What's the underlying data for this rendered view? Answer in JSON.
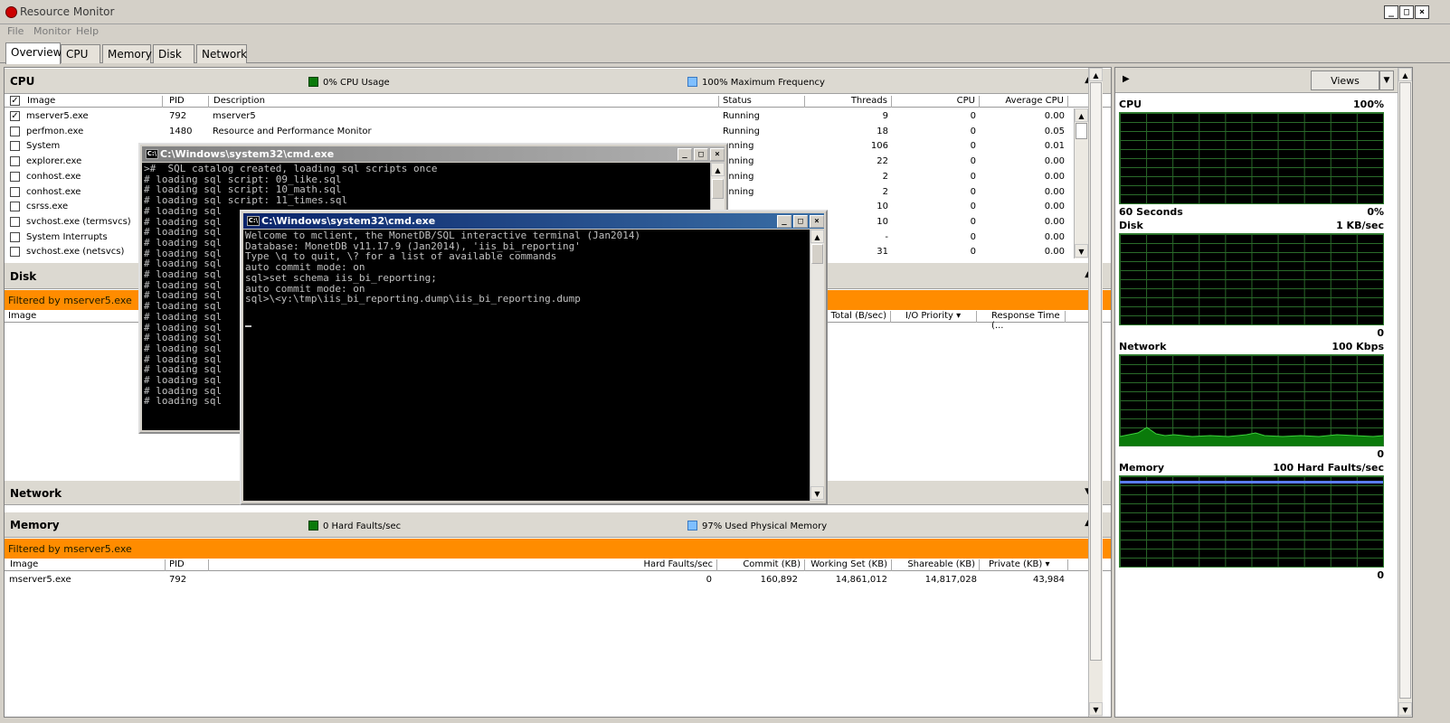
{
  "window": {
    "title": "Resource Monitor",
    "minimize": "_",
    "maximize": "□",
    "close": "×"
  },
  "menu": [
    "File",
    "Monitor",
    "Help"
  ],
  "tabs": [
    "Overview",
    "CPU",
    "Memory",
    "Disk",
    "Network"
  ],
  "cpu": {
    "title": "CPU",
    "usage": "0% CPU Usage",
    "frequency": "100% Maximum Frequency",
    "columns": [
      "Image",
      "PID",
      "Description",
      "Status",
      "Threads",
      "CPU",
      "Average CPU"
    ],
    "rows": [
      {
        "checked": true,
        "image": "mserver5.exe",
        "pid": "792",
        "desc": "mserver5",
        "status": "Running",
        "threads": "9",
        "cpu": "0",
        "avg": "0.00"
      },
      {
        "checked": false,
        "image": "perfmon.exe",
        "pid": "1480",
        "desc": "Resource and Performance Monitor",
        "status": "Running",
        "threads": "18",
        "cpu": "0",
        "avg": "0.05"
      },
      {
        "checked": false,
        "image": "System",
        "pid": "",
        "desc": "",
        "status": "unning",
        "threads": "106",
        "cpu": "0",
        "avg": "0.01"
      },
      {
        "checked": false,
        "image": "explorer.exe",
        "pid": "",
        "desc": "",
        "status": "unning",
        "threads": "22",
        "cpu": "0",
        "avg": "0.00"
      },
      {
        "checked": false,
        "image": "conhost.exe",
        "pid": "",
        "desc": "",
        "status": "unning",
        "threads": "2",
        "cpu": "0",
        "avg": "0.00"
      },
      {
        "checked": false,
        "image": "conhost.exe",
        "pid": "",
        "desc": "",
        "status": "unning",
        "threads": "2",
        "cpu": "0",
        "avg": "0.00"
      },
      {
        "checked": false,
        "image": "csrss.exe",
        "pid": "",
        "desc": "",
        "status": "",
        "threads": "10",
        "cpu": "0",
        "avg": "0.00"
      },
      {
        "checked": false,
        "image": "svchost.exe (termsvcs)",
        "pid": "",
        "desc": "",
        "status": "",
        "threads": "10",
        "cpu": "0",
        "avg": "0.00"
      },
      {
        "checked": false,
        "image": "System Interrupts",
        "pid": "",
        "desc": "",
        "status": "",
        "threads": "-",
        "cpu": "0",
        "avg": "0.00"
      },
      {
        "checked": false,
        "image": "svchost.exe (netsvcs)",
        "pid": "",
        "desc": "",
        "status": "",
        "threads": "31",
        "cpu": "0",
        "avg": "0.00"
      }
    ]
  },
  "disk": {
    "title": "Disk",
    "filter": "Filtered by mserver5.exe",
    "columns": [
      "Image",
      "Total (B/sec)",
      "I/O Priority",
      "Response Time (..."
    ]
  },
  "network": {
    "title": "Network"
  },
  "memory": {
    "title": "Memory",
    "hard_faults": "0 Hard Faults/sec",
    "used": "97% Used Physical Memory",
    "filter": "Filtered by mserver5.exe",
    "columns": [
      "Image",
      "PID",
      "Hard Faults/sec",
      "Commit (KB)",
      "Working Set (KB)",
      "Shareable (KB)",
      "Private (KB)"
    ],
    "rows": [
      {
        "image": "mserver5.exe",
        "pid": "792",
        "faults": "0",
        "commit": "160,892",
        "ws": "14,861,012",
        "share": "14,817,028",
        "private": "43,984"
      }
    ]
  },
  "right": {
    "views": "Views",
    "graphs": [
      {
        "name": "CPU",
        "max": "100%",
        "foot_left": "60 Seconds",
        "foot_right": "0%"
      },
      {
        "name": "Disk",
        "max": "1 KB/sec",
        "foot_left": "",
        "foot_right": "0"
      },
      {
        "name": "Network",
        "max": "100 Kbps",
        "foot_left": "",
        "foot_right": "0"
      },
      {
        "name": "Memory",
        "max": "100 Hard Faults/sec",
        "foot_left": "",
        "foot_right": "0"
      }
    ]
  },
  "cmd1": {
    "title": "C:\\Windows\\system32\\cmd.exe",
    "lines": [
      ">#  SQL catalog created, loading sql scripts once",
      "# loading sql script: 09_like.sql",
      "# loading sql script: 10_math.sql",
      "# loading sql script: 11_times.sql",
      "# loading sql",
      "# loading sql",
      "# loading sql",
      "# loading sql",
      "# loading sql",
      "# loading sql",
      "# loading sql",
      "# loading sql",
      "# loading sql",
      "# loading sql",
      "# loading sql",
      "# loading sql",
      "# loading sql",
      "# loading sql",
      "# loading sql",
      "# loading sql",
      "# loading sql",
      "# loading sql",
      "# loading sql"
    ]
  },
  "cmd2": {
    "title": "C:\\Windows\\system32\\cmd.exe",
    "lines": [
      "Welcome to mclient, the MonetDB/SQL interactive terminal (Jan2014)",
      "Database: MonetDB v11.17.9 (Jan2014), 'iis_bi_reporting'",
      "Type \\q to quit, \\? for a list of available commands",
      "auto commit mode: on",
      "sql>set schema iis_bi_reporting;",
      "auto commit mode: on",
      "sql>\\<y:\\tmp\\iis_bi_reporting.dump\\iis_bi_reporting.dump",
      "",
      ""
    ]
  }
}
